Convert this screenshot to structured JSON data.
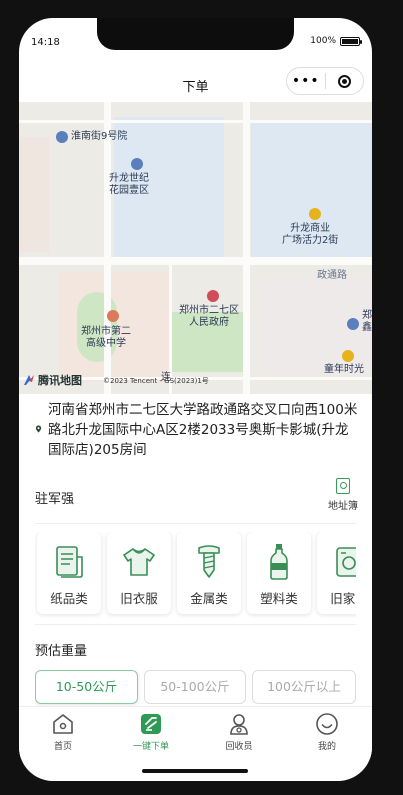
{
  "status": {
    "time": "14:18",
    "battery": "100%"
  },
  "nav": {
    "title": "下单",
    "menu_glyph": "•••"
  },
  "map": {
    "labels": [
      "淮南街9号院",
      "升龙世纪\n花园壹区",
      "升龙商业\n广场活力2街",
      "政通路",
      "郑州市二七区\n人民政府",
      "郑州市第二\n高级中学",
      "郑\n鑫",
      "童年时光",
      "连"
    ],
    "logo": "腾讯地图",
    "copyright": "©2023 Tencent - GS(2023)1号"
  },
  "address": {
    "text": "河南省郑州市二七区大学路政通路交叉口向西100米路北升龙国际中心A区2楼2033号奥斯卡影城(升龙国际店)205房间"
  },
  "collector": {
    "name": "驻军强",
    "address_book_label": "地址簿"
  },
  "categories": [
    {
      "label": "纸品类",
      "icon": "paper-icon"
    },
    {
      "label": "旧衣服",
      "icon": "clothes-icon"
    },
    {
      "label": "金属类",
      "icon": "screw-icon"
    },
    {
      "label": "塑料类",
      "icon": "bottle-icon"
    },
    {
      "label": "旧家电",
      "icon": "appliance-icon"
    }
  ],
  "weight": {
    "title": "预估重量",
    "options": [
      "10-50公斤",
      "50-100公斤",
      "100公斤以上"
    ],
    "selected": "10-50公斤"
  },
  "tabbar": [
    {
      "label": "首页",
      "icon": "home-icon"
    },
    {
      "label": "一键下单",
      "icon": "order-icon"
    },
    {
      "label": "回收员",
      "icon": "collector-icon"
    },
    {
      "label": "我的",
      "icon": "profile-icon"
    }
  ],
  "tabbar_active": "一键下单",
  "colors": {
    "accent": "#2f9a55",
    "accent_border": "#8ccba0"
  }
}
